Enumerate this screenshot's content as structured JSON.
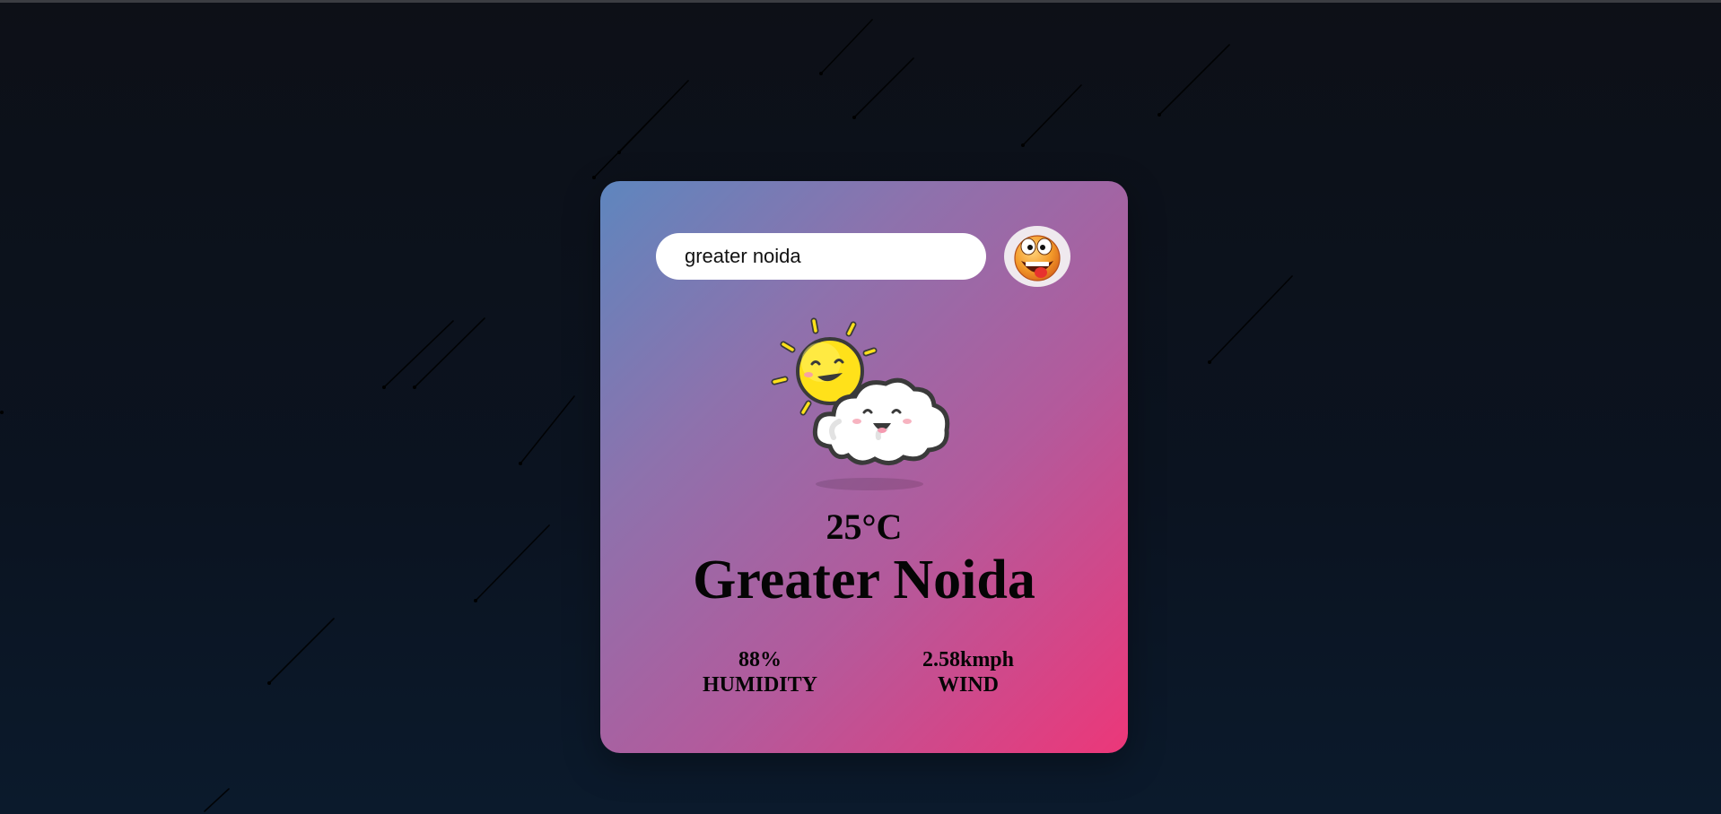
{
  "search": {
    "value": "greater noida",
    "button_icon": "funny-face-icon"
  },
  "weather": {
    "icon": "sun-behind-cloud-icon",
    "temperature": "25°C",
    "city": "Greater Noida",
    "humidity_value": "88%",
    "humidity_label": "HUMIDITY",
    "wind_value": "2.58kmph",
    "wind_label": "WIND"
  },
  "colors": {
    "background_dark": "#0d1017",
    "card_gradient_start": "#5e86be",
    "card_gradient_end": "#ec3779"
  }
}
